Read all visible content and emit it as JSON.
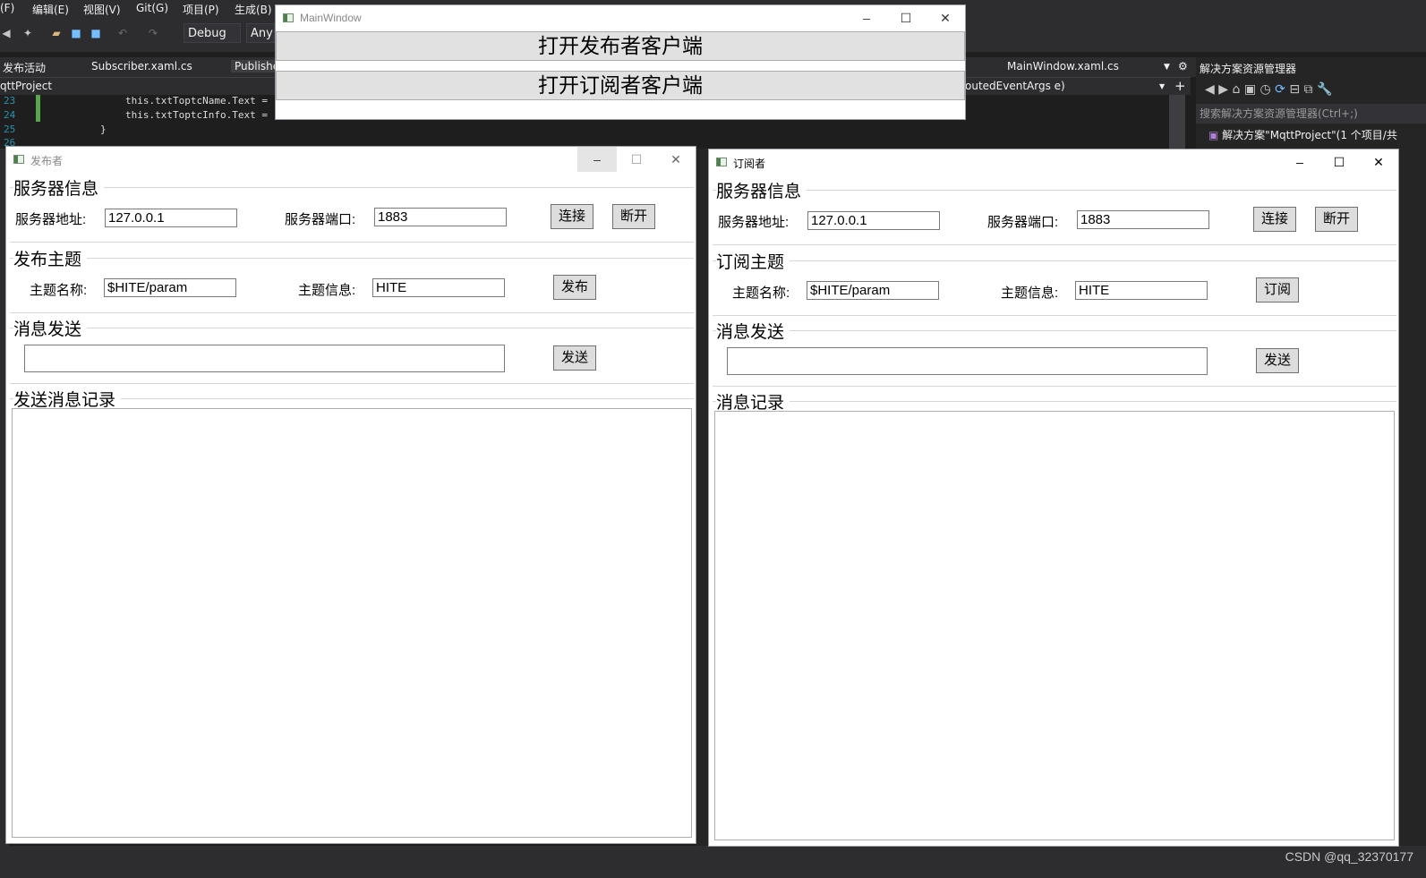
{
  "vs": {
    "menu": [
      "(F)",
      "编辑(E)",
      "视图(V)",
      "Git(G)",
      "项目(P)",
      "生成(B)"
    ],
    "config": "Debug",
    "platform": "Any C",
    "tabs": {
      "left": "发布活动",
      "subscriber": "Subscriber.xaml.cs",
      "publisher": "Publishe",
      "main": "MainWindow.xaml.cs"
    },
    "breadcrumb_left": "qttProject",
    "breadcrumb_right": "outedEventArgs e)",
    "code_lines": [
      {
        "num": "23",
        "text": "this.txtToptcName.Text ="
      },
      {
        "num": "24",
        "text": "this.txtToptcInfo.Text ="
      },
      {
        "num": "25",
        "text": "}"
      },
      {
        "num": "26",
        "text": ""
      }
    ],
    "solution_explorer": {
      "title": "解决方案资源管理器",
      "search_placeholder": "搜索解决方案资源管理器(Ctrl+;)",
      "root": "解决方案\"MqttProject\"(1 个项目/共"
    }
  },
  "main_window": {
    "title": "MainWindow",
    "open_publisher": "打开发布者客户端",
    "open_subscriber": "打开订阅者客户端"
  },
  "publisher": {
    "title": "发布者",
    "server_section": "服务器信息",
    "address_label": "服务器地址:",
    "address_value": "127.0.0.1",
    "port_label": "服务器端口:",
    "port_value": "1883",
    "connect": "连接",
    "disconnect": "断开",
    "topic_section": "发布主题",
    "topic_name_label": "主题名称:",
    "topic_name_value": "$HITE/param",
    "topic_info_label": "主题信息:",
    "topic_info_value": "HITE",
    "publish": "发布",
    "send_section": "消息发送",
    "message_value": "",
    "send": "发送",
    "log_section": "发送消息记录"
  },
  "subscriber": {
    "title": "订阅者",
    "server_section": "服务器信息",
    "address_label": "服务器地址:",
    "address_value": "127.0.0.1",
    "port_label": "服务器端口:",
    "port_value": "1883",
    "connect": "连接",
    "disconnect": "断开",
    "topic_section": "订阅主题",
    "topic_name_label": "主题名称:",
    "topic_name_value": "$HITE/param",
    "topic_info_label": "主题信息:",
    "topic_info_value": "HITE",
    "subscribe": "订阅",
    "send_section": "消息发送",
    "message_value": "",
    "send": "发送",
    "log_section": "消息记录"
  },
  "watermark": "CSDN @qq_32370177"
}
